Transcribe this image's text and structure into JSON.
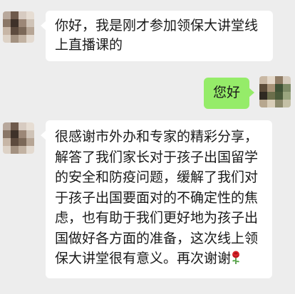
{
  "colors": {
    "background": "#ededed",
    "left_bubble": "#ffffff",
    "right_bubble": "#95ec69"
  },
  "messages": [
    {
      "side": "left",
      "text": "你好，我是刚才参加领保大讲堂线上直播课的"
    },
    {
      "side": "right",
      "text": "您好"
    },
    {
      "side": "left",
      "text": "很感谢市外办和专家的精彩分享，解答了我们家长对于孩子出国留学的安全和防疫问题，缓解了我们对于孩子出国要面对的不确定性的焦虑，也有助于我们更好地为孩子出国做好各方面的准备，这次线上领保大讲堂很有意义。再次谢谢",
      "emoji": "rose-icon"
    }
  ]
}
